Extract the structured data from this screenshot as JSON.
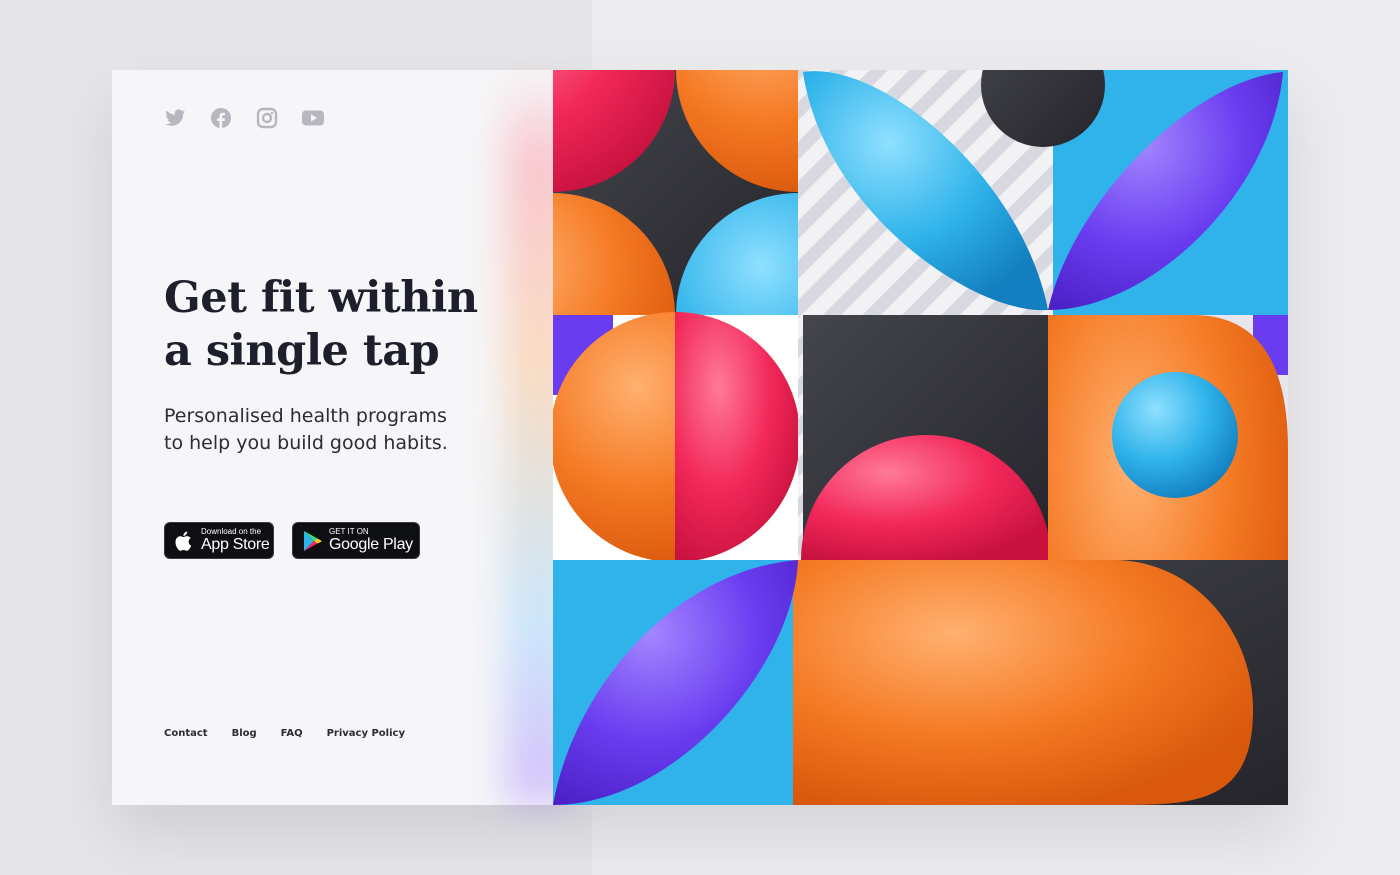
{
  "social": {
    "icons": [
      "twitter-icon",
      "facebook-icon",
      "instagram-icon",
      "youtube-icon"
    ]
  },
  "hero": {
    "headline_line1": "Get fit within",
    "headline_line2": "a single tap",
    "sub_line1": "Personalised health programs",
    "sub_line2": "to help you build good habits."
  },
  "stores": {
    "apple_small": "Download on the",
    "apple_big": "App Store",
    "google_small": "GET IT ON",
    "google_big": "Google Play"
  },
  "footer": {
    "links": [
      "Contact",
      "Blog",
      "FAQ",
      "Privacy Policy"
    ]
  },
  "colors": {
    "text_dark": "#1d1f2b",
    "panel_bg": "#f6f6f8",
    "orange": "#f57a24",
    "pink": "#f2285a",
    "blue": "#2fb3ea",
    "purple": "#6a3cf0",
    "charcoal": "#2d2d33"
  }
}
